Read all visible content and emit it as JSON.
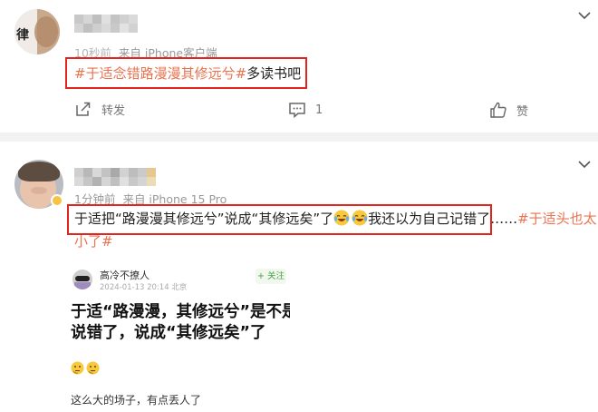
{
  "post1": {
    "avatar_text": "律",
    "meta_time": "10秒前",
    "meta_source": "来自 iPhone客户端",
    "content_tag": "#于适念错路漫漫其修远兮#",
    "content_text": "多读书吧",
    "actions": {
      "repost_label": "转发",
      "comment_count": "1",
      "like_label": "赞"
    }
  },
  "post2": {
    "meta_time": "1分钟前",
    "meta_source": "来自 iPhone 15 Pro",
    "content_line1": "于适把“路漫漫其修远兮”说成“其修远矣”了",
    "content_line1_after": "我还以为自己记错了……",
    "content_tag_part1": "#于适头也太",
    "content_tag_part2": "小了#",
    "quote": {
      "user_name": "高冷不撩人",
      "time_location": "2024-01-13 20:14  北京",
      "follow_label": "+ 关注",
      "body_line1": "于适“路漫漫，其修远兮”是不是",
      "body_line2": "说错了，说成“其修远矣”了",
      "footer_text": "这么大的场子，有点丢人了"
    }
  },
  "colors": {
    "tag": "#eb7350",
    "highlight_box": "#e0261e",
    "meta": "#999999",
    "follow_green": "#48a148",
    "divider": "#f2f2f2"
  },
  "icons": [
    "chevron-down-icon",
    "repost-icon",
    "comment-icon",
    "like-icon",
    "laugh-cry-emoji-icon",
    "thinking-emoji-icon"
  ]
}
